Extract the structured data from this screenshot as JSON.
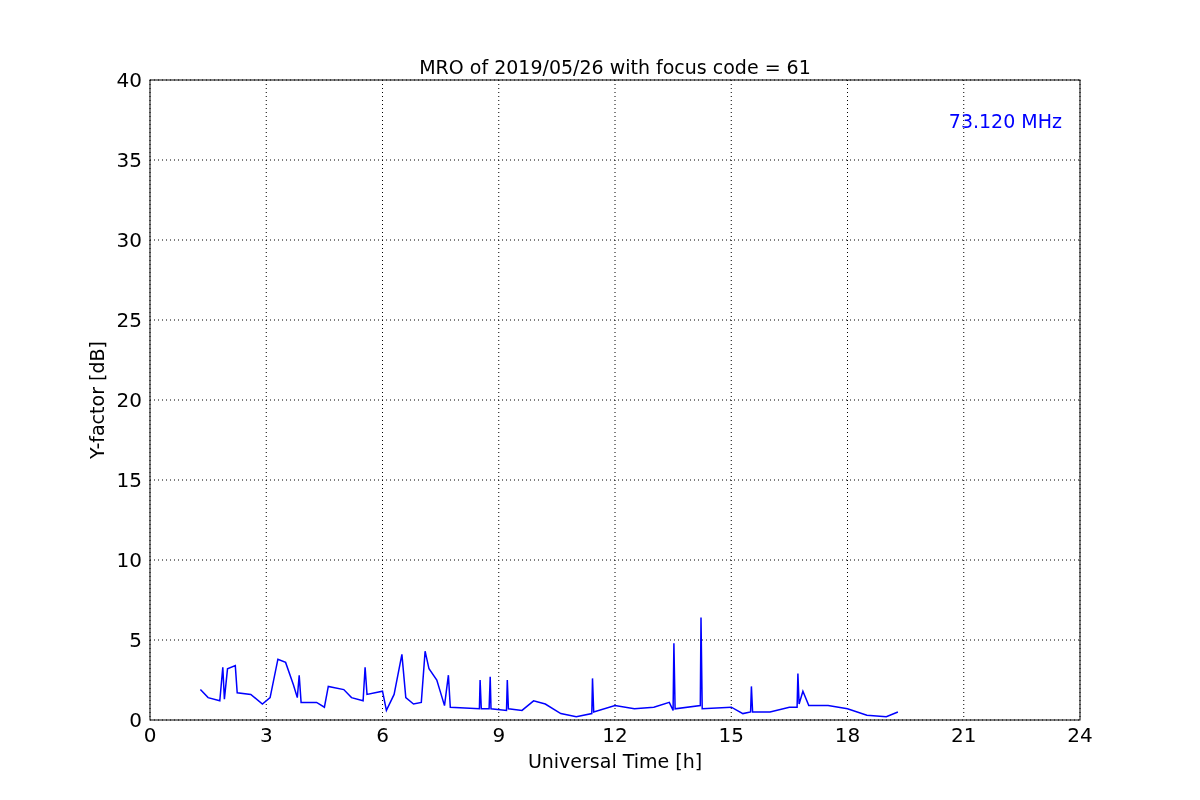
{
  "chart_data": {
    "type": "line",
    "title": "MRO of 2019/05/26 with focus code = 61",
    "xlabel": "Universal Time [h]",
    "ylabel": "Y-factor [dB]",
    "xlim": [
      0,
      24
    ],
    "ylim": [
      0,
      40
    ],
    "xticks": [
      0,
      3,
      6,
      9,
      12,
      15,
      18,
      21,
      24
    ],
    "yticks": [
      0,
      5,
      10,
      15,
      20,
      25,
      30,
      35,
      40
    ],
    "x": [
      1.3,
      1.5,
      1.8,
      1.88,
      1.92,
      2.0,
      2.2,
      2.25,
      2.6,
      2.9,
      3.1,
      3.3,
      3.5,
      3.7,
      3.8,
      3.85,
      3.9,
      4.3,
      4.5,
      4.6,
      5.0,
      5.2,
      5.5,
      5.55,
      5.6,
      6.0,
      6.1,
      6.3,
      6.5,
      6.6,
      6.8,
      7.0,
      7.1,
      7.2,
      7.4,
      7.6,
      7.7,
      7.75,
      8.5,
      8.52,
      8.55,
      8.75,
      8.78,
      8.8,
      9.2,
      9.22,
      9.25,
      9.6,
      9.9,
      10.2,
      10.6,
      11.0,
      11.4,
      11.42,
      11.45,
      12.0,
      12.5,
      13.0,
      13.4,
      13.5,
      13.52,
      13.55,
      14.2,
      14.22,
      14.25,
      15.0,
      15.3,
      15.5,
      15.52,
      15.55,
      16.0,
      16.5,
      16.7,
      16.72,
      16.75,
      16.85,
      17.0,
      17.5,
      18.0,
      18.5,
      19.0,
      19.3
    ],
    "series": [
      {
        "name": "73.120 MHz",
        "color": "#0000ff",
        "values": [
          1.9,
          1.4,
          1.2,
          3.3,
          1.3,
          3.2,
          3.4,
          1.7,
          1.6,
          1.0,
          1.4,
          3.8,
          3.6,
          2.2,
          1.4,
          2.8,
          1.1,
          1.1,
          0.8,
          2.1,
          1.9,
          1.4,
          1.2,
          3.3,
          1.6,
          1.8,
          0.6,
          1.6,
          4.1,
          1.4,
          1.0,
          1.1,
          4.3,
          3.2,
          2.5,
          0.9,
          2.8,
          0.8,
          0.7,
          2.5,
          0.7,
          0.7,
          2.7,
          0.7,
          0.6,
          2.5,
          0.7,
          0.6,
          1.2,
          1.0,
          0.4,
          0.2,
          0.4,
          2.6,
          0.5,
          0.9,
          0.7,
          0.8,
          1.1,
          0.6,
          4.8,
          0.7,
          0.9,
          6.4,
          0.7,
          0.8,
          0.4,
          0.5,
          2.1,
          0.5,
          0.5,
          0.8,
          0.8,
          2.9,
          1.0,
          1.8,
          0.9,
          0.9,
          0.7,
          0.3,
          0.2,
          0.5
        ]
      }
    ],
    "grid": true
  }
}
